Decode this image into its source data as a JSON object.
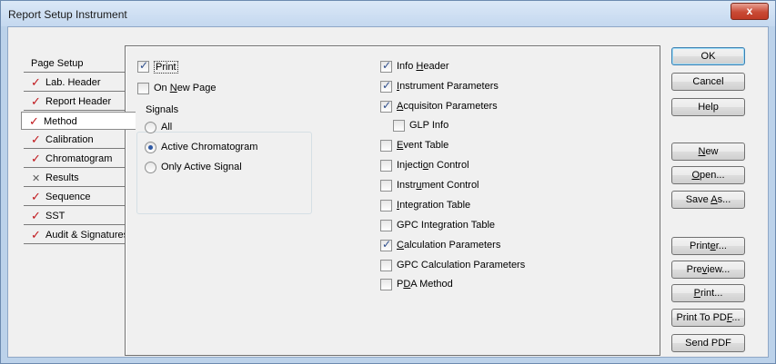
{
  "window": {
    "title": "Report Setup Instrument",
    "close_label": "x"
  },
  "tabs": [
    {
      "label": "Page Setup",
      "mark": ""
    },
    {
      "label": "Lab. Header",
      "mark": "check"
    },
    {
      "label": "Report Header",
      "mark": "check"
    },
    {
      "label": "Method",
      "mark": "check",
      "active": true
    },
    {
      "label": "Calibration",
      "mark": "check"
    },
    {
      "label": "Chromatogram",
      "mark": "check"
    },
    {
      "label": "Results",
      "mark": "x"
    },
    {
      "label": "Sequence",
      "mark": "check"
    },
    {
      "label": "SST",
      "mark": "check"
    },
    {
      "label": "Audit & Signatures",
      "mark": "check"
    }
  ],
  "left_options": {
    "print": {
      "label": "Print",
      "checked": true
    },
    "on_new_page": {
      "label_pre": "On ",
      "label_u": "N",
      "label_post": "ew Page",
      "checked": false
    },
    "signals": {
      "title": "Signals",
      "options": [
        {
          "label": "All",
          "selected": false
        },
        {
          "label": "Active Chromatogram",
          "selected": true
        },
        {
          "label": "Only Active Signal",
          "selected": false
        }
      ]
    }
  },
  "right_options": [
    {
      "pre": "Info ",
      "u": "H",
      "post": "eader",
      "checked": true
    },
    {
      "pre": "",
      "u": "I",
      "post": "nstrument Parameters",
      "checked": true
    },
    {
      "pre": "",
      "u": "A",
      "post": "cquisiton Parameters",
      "checked": true
    },
    {
      "pre": "GLP Info",
      "u": "",
      "post": "",
      "checked": false,
      "indent": true
    },
    {
      "pre": "",
      "u": "E",
      "post": "vent Table",
      "checked": false
    },
    {
      "pre": "Injecti",
      "u": "o",
      "post": "n Control",
      "checked": false
    },
    {
      "pre": "Instr",
      "u": "u",
      "post": "ment Control",
      "checked": false
    },
    {
      "pre": "",
      "u": "I",
      "post": "ntegration Table",
      "checked": false
    },
    {
      "pre": "GPC Integration Table",
      "u": "",
      "post": "",
      "checked": false
    },
    {
      "pre": "",
      "u": "C",
      "post": "alculation Parameters",
      "checked": true
    },
    {
      "pre": "GPC Calculation Parameters",
      "u": "",
      "post": "",
      "checked": false
    },
    {
      "pre": "P",
      "u": "D",
      "post": "A Method",
      "checked": false
    }
  ],
  "buttons": [
    {
      "pre": "OK",
      "u": "",
      "post": ""
    },
    {
      "pre": "Cancel",
      "u": "",
      "post": ""
    },
    {
      "pre": "Help",
      "u": "",
      "post": ""
    },
    {
      "pre": "",
      "u": "N",
      "post": "ew"
    },
    {
      "pre": "",
      "u": "O",
      "post": "pen..."
    },
    {
      "pre": "Save ",
      "u": "A",
      "post": "s..."
    },
    {
      "pre": "Print",
      "u": "e",
      "post": "r..."
    },
    {
      "pre": "Pre",
      "u": "v",
      "post": "iew..."
    },
    {
      "pre": "",
      "u": "P",
      "post": "rint..."
    },
    {
      "pre": "Print To PD",
      "u": "F",
      "post": "..."
    },
    {
      "pre": "Send PDF",
      "u": "",
      "post": ""
    }
  ]
}
